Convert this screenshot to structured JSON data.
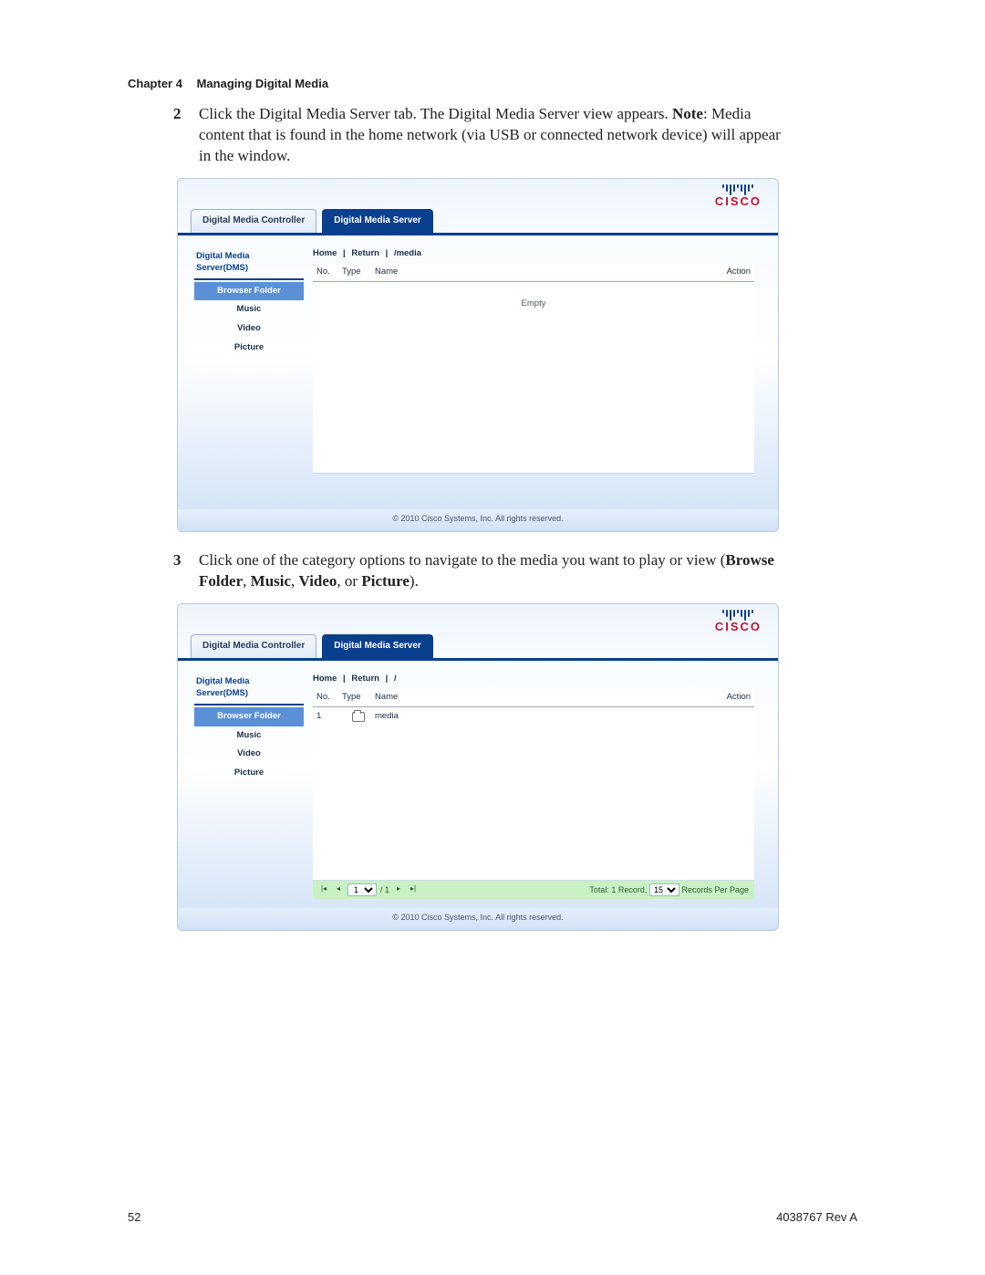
{
  "header": {
    "chapter_label": "Chapter 4",
    "chapter_title": "Managing Digital Media"
  },
  "steps": {
    "s2": {
      "num": "2",
      "text_a": "Click the Digital Media Server tab. The Digital Media Server view appears. ",
      "note_label": "Note",
      "note_text": ": Media content that is found in the home network (via USB or connected network device) will appear in the window."
    },
    "s3": {
      "num": "3",
      "text_a": "Click one of the category options to navigate to the media you want to play or view (",
      "b1": "Browse Folder",
      "c1": ", ",
      "b2": "Music",
      "c2": ", ",
      "b3": "Video",
      "c3": ", or ",
      "b4": "Picture",
      "c4": ")."
    }
  },
  "app": {
    "logo_word": "CISCO",
    "tabs": [
      {
        "label": "Digital Media Controller"
      },
      {
        "label": "Digital Media Server"
      }
    ],
    "sidebar": {
      "title": "Digital Media Server(DMS)",
      "items": [
        {
          "label": "Browser Folder"
        },
        {
          "label": "Music"
        },
        {
          "label": "Video"
        },
        {
          "label": "Picture"
        }
      ]
    },
    "crumb": {
      "home": "Home",
      "return": "Return"
    },
    "columns": {
      "no": "No.",
      "type": "Type",
      "name": "Name",
      "action": "Action"
    },
    "copyright": "© 2010 Cisco Systems, Inc. All rights reserved."
  },
  "shot1": {
    "breadcrumb_path": "/media",
    "empty": "Empty"
  },
  "shot2": {
    "breadcrumb_path": "/",
    "row": {
      "no": "1",
      "name": "media"
    },
    "pager": {
      "page": "1",
      "of_label": "/ 1",
      "total_label": "Total: 1 Record,",
      "per_page_value": "15",
      "per_page_label": "Records Per Page"
    }
  },
  "footer": {
    "page_no": "52",
    "doc_id": "4038767 Rev A"
  }
}
